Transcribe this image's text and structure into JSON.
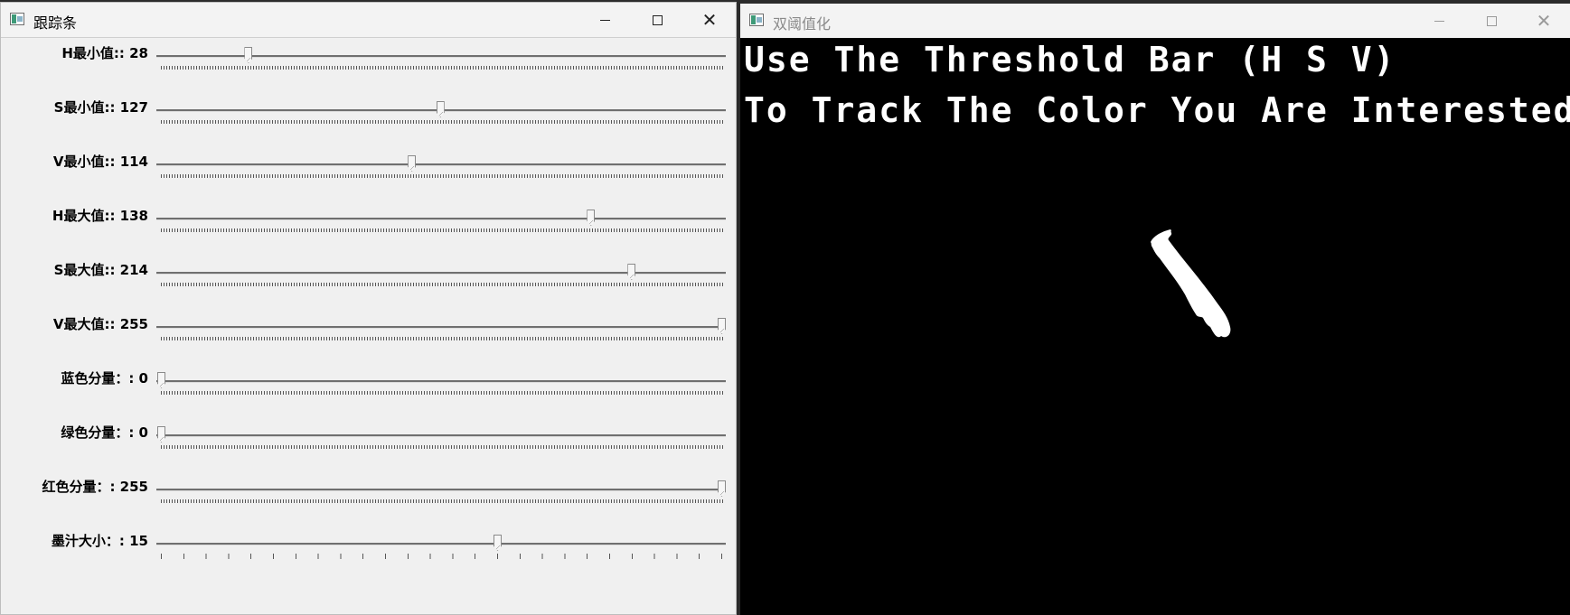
{
  "left_window": {
    "title": "跟踪条",
    "trackbars": [
      {
        "label": "H最小值:: 28",
        "value": 28,
        "max": 180,
        "sparse": false
      },
      {
        "label": "S最小值:: 127",
        "value": 127,
        "max": 255,
        "sparse": false
      },
      {
        "label": "V最小值:: 114",
        "value": 114,
        "max": 255,
        "sparse": false
      },
      {
        "label": "H最大值:: 138",
        "value": 138,
        "max": 180,
        "sparse": false
      },
      {
        "label": "S最大值:: 214",
        "value": 214,
        "max": 255,
        "sparse": false
      },
      {
        "label": "V最大值:: 255",
        "value": 255,
        "max": 255,
        "sparse": false
      },
      {
        "label": "蓝色分量：: 0",
        "value": 0,
        "max": 255,
        "sparse": false
      },
      {
        "label": "绿色分量：: 0",
        "value": 0,
        "max": 255,
        "sparse": false
      },
      {
        "label": "红色分量：: 255",
        "value": 255,
        "max": 255,
        "sparse": false
      },
      {
        "label": "墨汁大小：: 15",
        "value": 15,
        "max": 25,
        "sparse": true
      }
    ]
  },
  "right_window": {
    "title": "双阈值化",
    "overlay_line1": "Use The Threshold Bar (H S V)",
    "overlay_line2": "To Track The Color You Are Interested......"
  },
  "colors": {
    "window_bg": "#f0f0f0",
    "canvas_bg": "#000000",
    "overlay_text": "#ffffff"
  },
  "icons": {
    "app": "opencv-window-icon",
    "minimize": "minimize-icon",
    "maximize": "maximize-icon",
    "close": "close-icon"
  }
}
